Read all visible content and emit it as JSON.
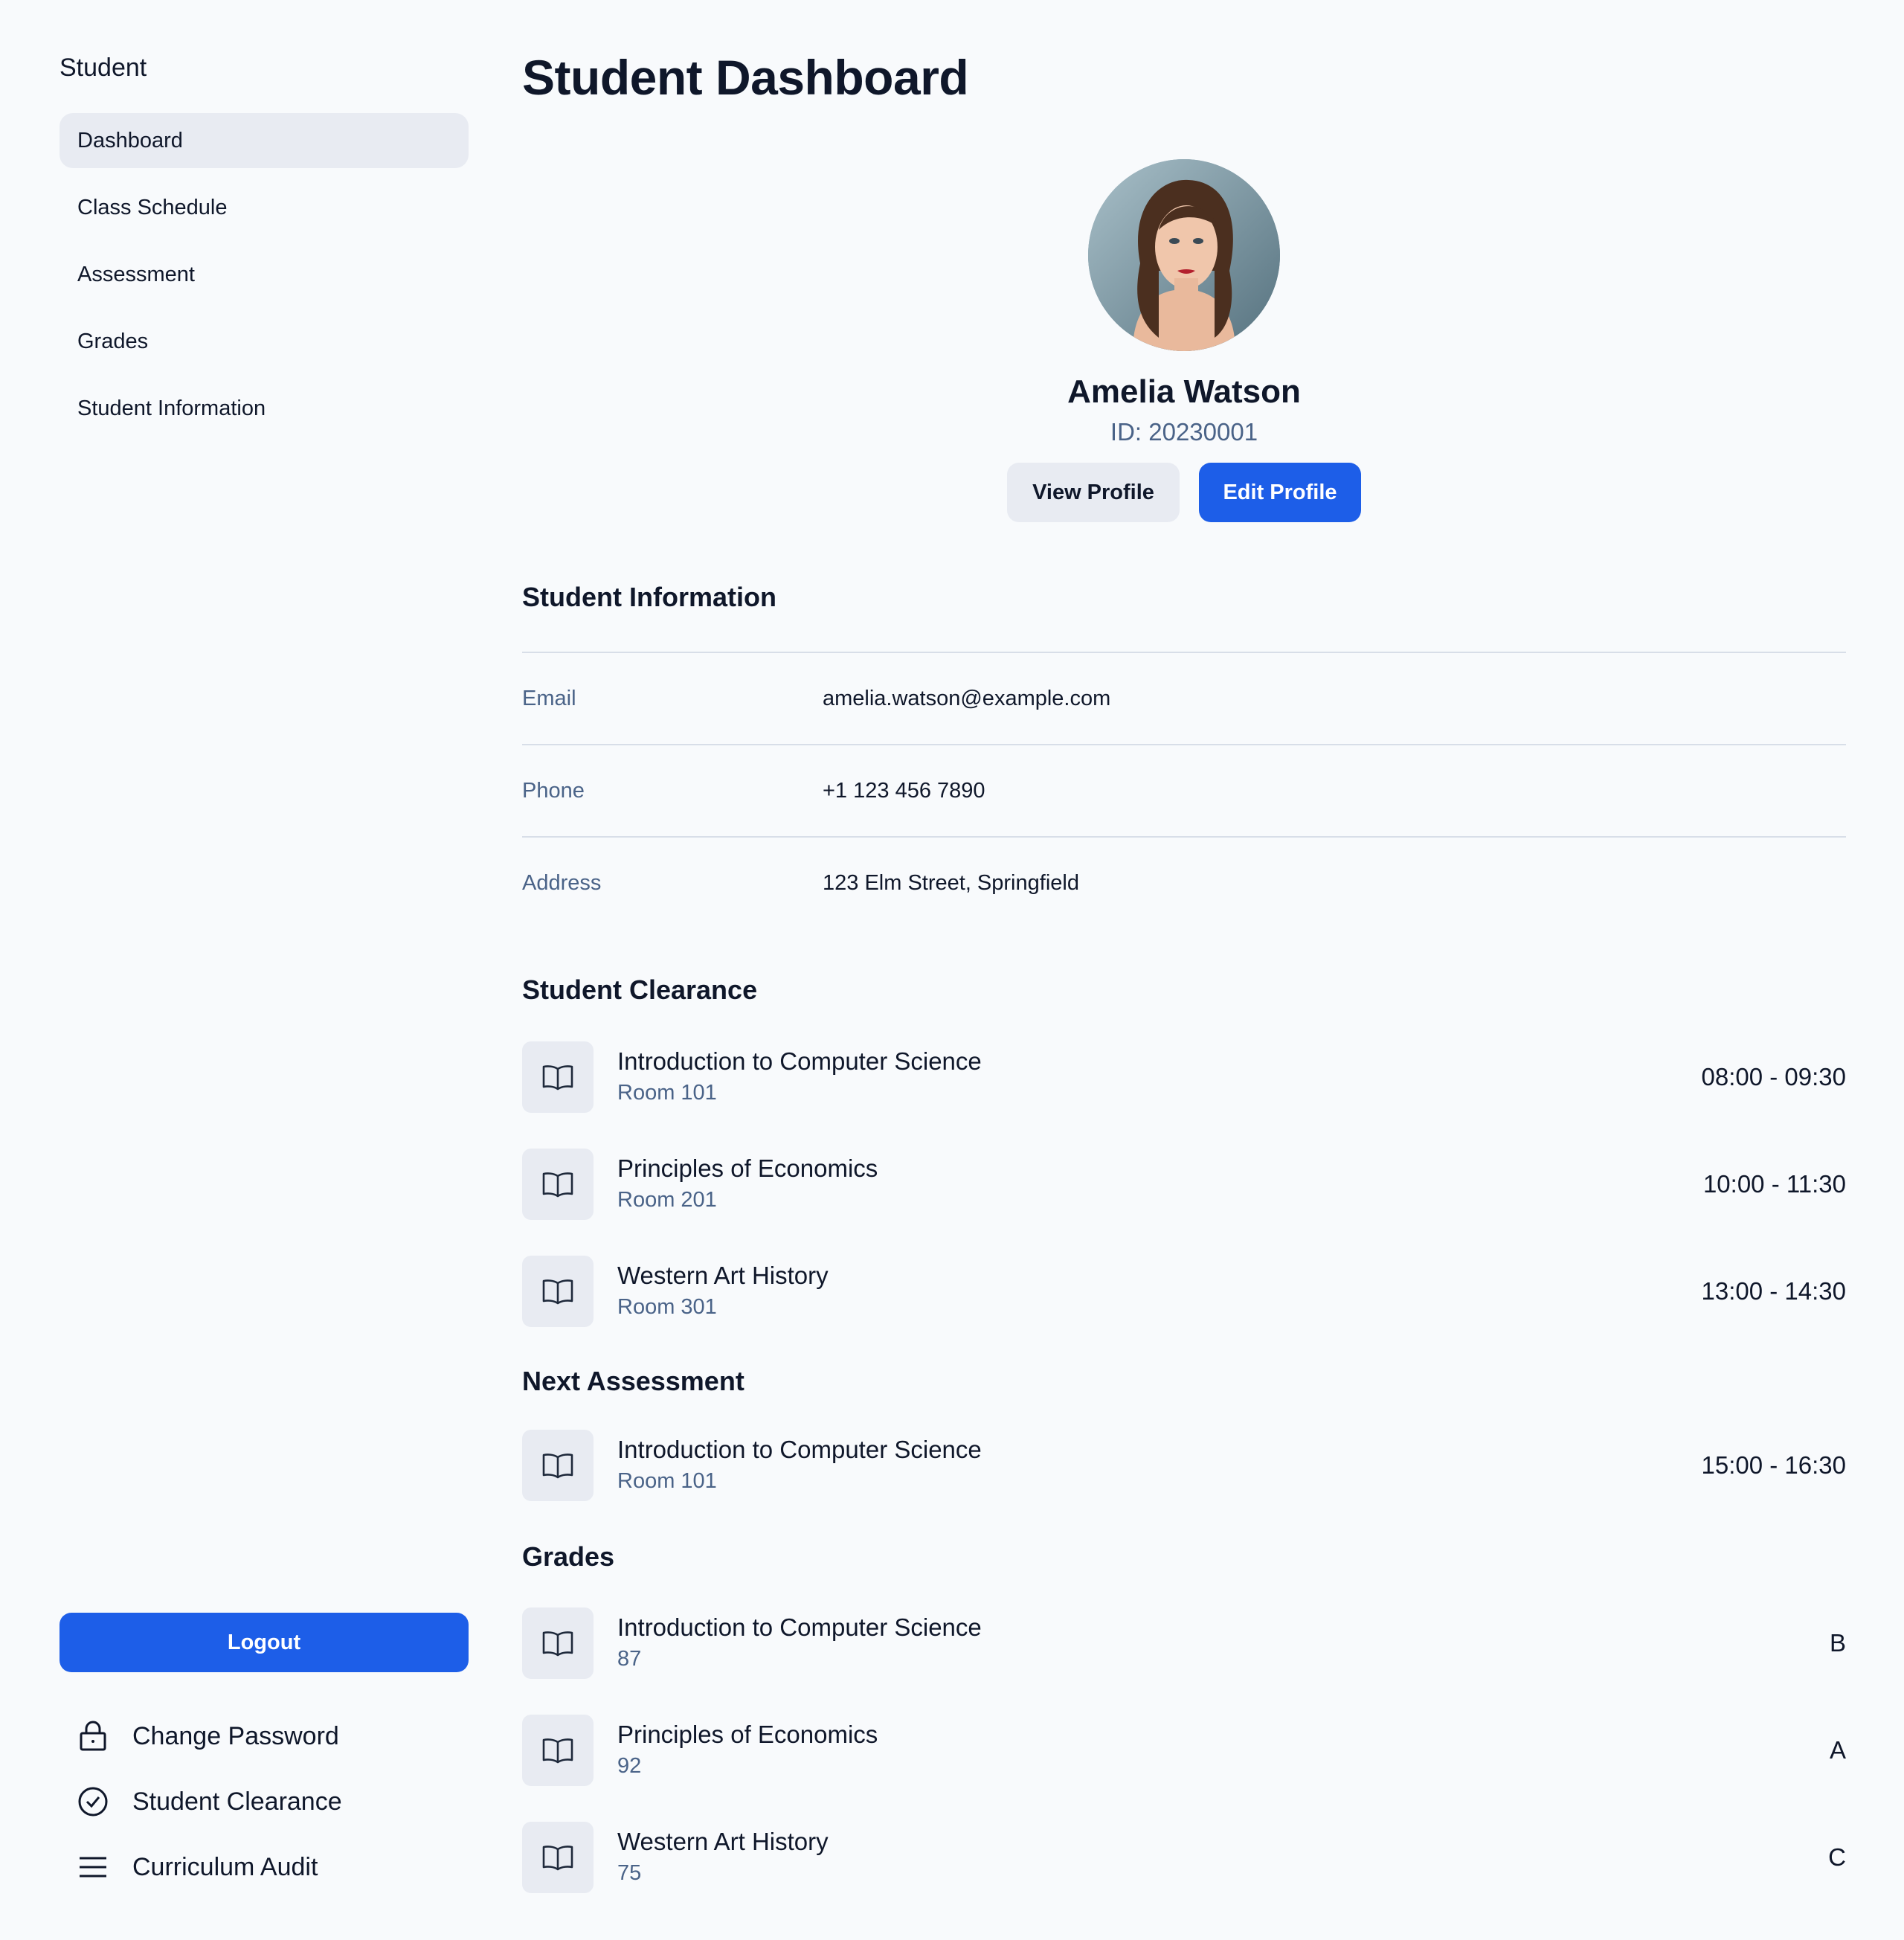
{
  "sidebar": {
    "title": "Student",
    "nav": [
      {
        "label": "Dashboard",
        "active": true
      },
      {
        "label": "Class Schedule",
        "active": false
      },
      {
        "label": "Assessment",
        "active": false
      },
      {
        "label": "Grades",
        "active": false
      },
      {
        "label": "Student Information",
        "active": false
      }
    ],
    "logout_label": "Logout",
    "links": [
      {
        "label": "Change Password",
        "icon": "lock-icon"
      },
      {
        "label": "Student Clearance",
        "icon": "check-circle-icon"
      },
      {
        "label": "Curriculum Audit",
        "icon": "menu-icon"
      }
    ]
  },
  "page": {
    "title": "Student Dashboard"
  },
  "profile": {
    "name": "Amelia Watson",
    "id_text": "ID: 20230001",
    "view_label": "View Profile",
    "edit_label": "Edit Profile"
  },
  "student_information": {
    "title": "Student Information",
    "rows": [
      {
        "label": "Email",
        "value": "amelia.watson@example.com"
      },
      {
        "label": "Phone",
        "value": "+1 123 456 7890"
      },
      {
        "label": "Address",
        "value": "123 Elm Street, Springfield"
      }
    ]
  },
  "clearance": {
    "title": "Student Clearance",
    "items": [
      {
        "course": "Introduction to Computer Science",
        "room": "Room 101",
        "time": "08:00 - 09:30"
      },
      {
        "course": "Principles of Economics",
        "room": "Room 201",
        "time": "10:00 - 11:30"
      },
      {
        "course": "Western Art History",
        "room": "Room 301",
        "time": "13:00 - 14:30"
      }
    ]
  },
  "assessment": {
    "title": "Next Assessment",
    "items": [
      {
        "course": "Introduction to Computer Science",
        "room": "Room 101",
        "time": "15:00 - 16:30"
      }
    ]
  },
  "grades": {
    "title": "Grades",
    "items": [
      {
        "course": "Introduction to Computer Science",
        "score": "87",
        "grade": "B"
      },
      {
        "course": "Principles of Economics",
        "score": "92",
        "grade": "A"
      },
      {
        "course": "Western Art History",
        "score": "75",
        "grade": "C"
      }
    ]
  },
  "colors": {
    "accent": "#1d5ee8",
    "muted_text": "#4a6388",
    "surface": "#e8ebf2"
  }
}
